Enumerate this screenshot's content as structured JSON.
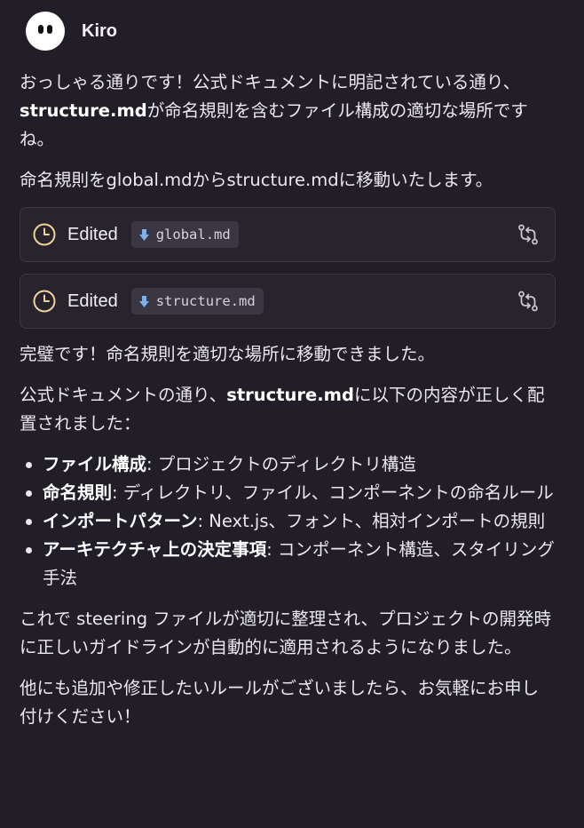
{
  "header": {
    "name": "Kiro"
  },
  "message": {
    "para1_a": "おっしゃる通りです！公式ドキュメントに明記されている通り、",
    "para1_strong": "structure.md",
    "para1_b": "が命名規則を含むファイル構成の適切な場所ですね。",
    "para2": "命名規則をglobal.mdからstructure.mdに移動いたします。",
    "edits": [
      {
        "label": "Edited",
        "file": "global.md"
      },
      {
        "label": "Edited",
        "file": "structure.md"
      }
    ],
    "para3": "完璧です！命名規則を適切な場所に移動できました。",
    "para4_a": "公式ドキュメントの通り、",
    "para4_strong": "structure.md",
    "para4_b": "に以下の内容が正しく配置されました：",
    "bullets": [
      {
        "title": "ファイル構成",
        "text": ": プロジェクトのディレクトリ構造"
      },
      {
        "title": "命名規則",
        "text": ": ディレクトリ、ファイル、コンポーネントの命名ルール"
      },
      {
        "title": "インポートパターン",
        "text": ": Next.js、フォント、相対インポートの規則"
      },
      {
        "title": "アーキテクチャ上の決定事項",
        "text": ": コンポーネント構造、スタイリング手法"
      }
    ],
    "para5": "これで steering ファイルが適切に整理され、プロジェクトの開発時に正しいガイドラインが自動的に適用されるようになりました。",
    "para6": "他にも追加や修正したいルールがございましたら、お気軽にお申し付けください！"
  },
  "colors": {
    "background": "#211e27",
    "card": "#27242e",
    "clock_accent": "#f3d19b",
    "md_icon": "#7fb1e6"
  },
  "icons": {
    "avatar": "kiro-ghost-avatar",
    "edited": "clock-icon",
    "file": "markdown-down-arrow-icon",
    "action": "diff-compare-icon"
  }
}
